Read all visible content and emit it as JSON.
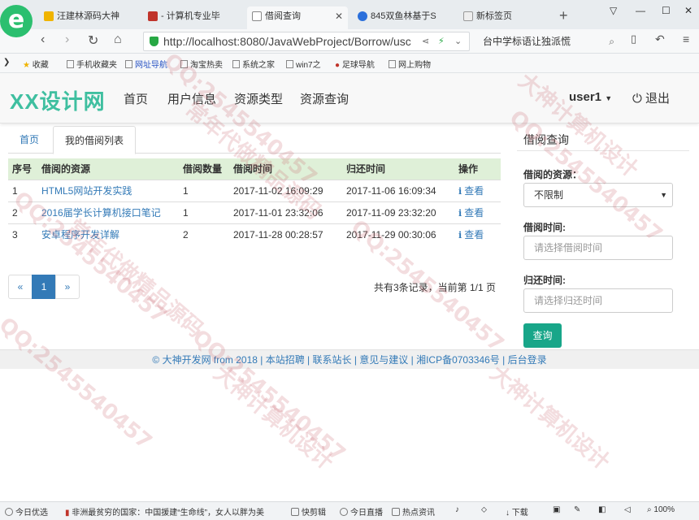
{
  "browser": {
    "tabs": [
      {
        "title": "汪建林源码大神"
      },
      {
        "title": "- 计算机专业毕"
      },
      {
        "title": "借阅查询"
      },
      {
        "title": "845双鱼林基于S"
      },
      {
        "title": "新标签页"
      }
    ],
    "url": "http://localhost:8080/JavaWebProject/Borrow/usc",
    "search_text": "台中学标语让独派慌",
    "bookmarks": [
      "收藏",
      "手机收藏夹",
      "网址导航",
      "淘宝热卖",
      "系统之家",
      "win7之",
      "足球导航",
      "网上购物"
    ]
  },
  "site": {
    "brand": "XX设计网",
    "nav": [
      "首页",
      "用户信息",
      "资源类型",
      "资源查询"
    ],
    "user": "user1",
    "logout": "退出"
  },
  "content_tabs": {
    "home": "首页",
    "current": "我的借阅列表"
  },
  "table": {
    "headers": [
      "序号",
      "借阅的资源",
      "借阅数量",
      "借阅时间",
      "归还时间",
      "操作"
    ],
    "rows": [
      {
        "no": "1",
        "resource": "HTML5网站开发实践",
        "qty": "1",
        "borrow_time": "2017-11-02 16:09:29",
        "return_time": "2017-11-06 16:09:34",
        "action": "查看"
      },
      {
        "no": "2",
        "resource": "2016届学长计算机接口笔记",
        "qty": "1",
        "borrow_time": "2017-11-01 23:32:06",
        "return_time": "2017-11-09 23:32:20",
        "action": "查看"
      },
      {
        "no": "3",
        "resource": "安卓程序开发详解",
        "qty": "2",
        "borrow_time": "2017-11-28 00:28:57",
        "return_time": "2017-11-29 00:30:06",
        "action": "查看"
      }
    ]
  },
  "pagination": {
    "prev": "«",
    "current": "1",
    "next": "»",
    "summary": "共有3条记录，当前第 1/1 页"
  },
  "sidebar": {
    "title": "借阅查询",
    "resource_label": "借阅的资源：",
    "resource_value": "不限制",
    "borrow_label": "借阅时间:",
    "borrow_placeholder": "请选择借阅时间",
    "return_label": "归还时间:",
    "return_placeholder": "请选择归还时间",
    "query_button": "查询"
  },
  "footer": {
    "text": "© 大神开发网 from 2018 | 本站招聘 | 联系站长 | 意见与建议 | 湘ICP备0703346号 | 后台登录"
  },
  "statusbar": {
    "items": [
      "今日优选",
      "非洲最贫穷的国家：中国援建“生命线”，女人以胖为美",
      "快剪辑",
      "今日直播",
      "热点资讯",
      "下载"
    ],
    "zoom": "100%"
  },
  "watermarks": [
    "QQ:2545540457",
    "常年代做精品源码",
    "大神计算机设计"
  ],
  "colors": {
    "brand": "#3fbfa0",
    "link": "#337ab7",
    "table_header": "#dff0d8",
    "query_button": "#18a689",
    "watermark": "#c8646e"
  }
}
